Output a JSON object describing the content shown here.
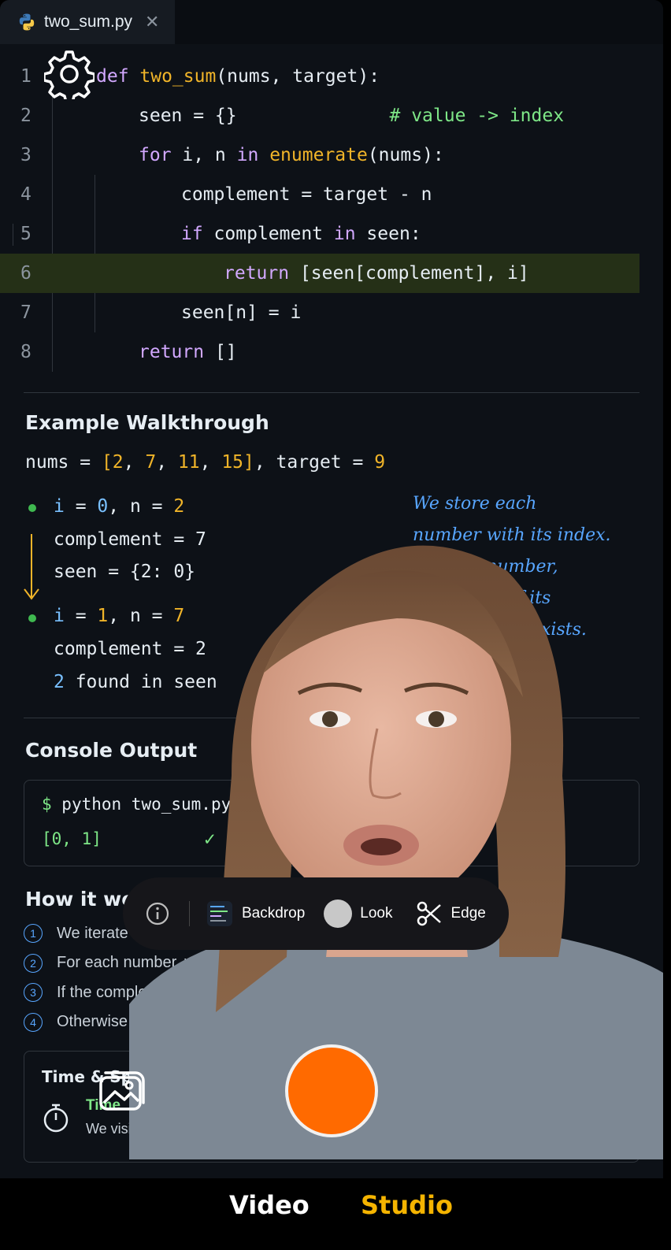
{
  "tab": {
    "filename": "two_sum.py",
    "close_glyph": "✕"
  },
  "code": {
    "lines": [
      {
        "num": "1",
        "parts": [
          [
            "kw",
            "def "
          ],
          [
            "fn",
            "two_sum"
          ],
          [
            "pl",
            "(nums, target):"
          ]
        ]
      },
      {
        "num": "2",
        "parts": [
          [
            "pl",
            "seen = {}"
          ],
          [
            "gap",
            "              "
          ],
          [
            "cm",
            "# value -> index"
          ]
        ]
      },
      {
        "num": "3",
        "parts": [
          [
            "kw",
            "for"
          ],
          [
            "pl",
            " i, n "
          ],
          [
            "kw",
            "in"
          ],
          [
            "pl",
            " "
          ],
          [
            "fn",
            "enumerate"
          ],
          [
            "pl",
            "(nums):"
          ]
        ]
      },
      {
        "num": "4",
        "parts": [
          [
            "pl",
            "complement = target - n"
          ]
        ]
      },
      {
        "num": "5",
        "parts": [
          [
            "kw",
            "if"
          ],
          [
            "pl",
            " complement "
          ],
          [
            "kw",
            "in"
          ],
          [
            "pl",
            " seen:"
          ]
        ]
      },
      {
        "num": "6",
        "parts": [
          [
            "kw",
            "return"
          ],
          [
            "pl",
            " [seen[complement], i]"
          ]
        ]
      },
      {
        "num": "7",
        "parts": [
          [
            "pl",
            "seen[n] = i"
          ]
        ]
      },
      {
        "num": "8",
        "parts": [
          [
            "kw",
            "return"
          ],
          [
            "pl",
            " []"
          ]
        ]
      }
    ]
  },
  "walkthrough": {
    "title": "Example Walkthrough",
    "input_parts": [
      [
        "pl",
        "nums = "
      ],
      [
        "num",
        "[2"
      ],
      [
        "pl",
        ", "
      ],
      [
        "num",
        "7"
      ],
      [
        "pl",
        ", "
      ],
      [
        "num",
        "11"
      ],
      [
        "pl",
        ", "
      ],
      [
        "num",
        "15]"
      ],
      [
        "pl",
        ", target = "
      ],
      [
        "num",
        "9"
      ]
    ],
    "step1": {
      "head": [
        [
          "var",
          "i"
        ],
        [
          "pl",
          " = "
        ],
        [
          "var",
          "0"
        ],
        [
          "pl",
          ", n = "
        ],
        [
          "num",
          "2"
        ]
      ],
      "l2": "complement = 7",
      "l3": "seen = {2: 0}"
    },
    "step2": {
      "head": [
        [
          "var",
          "i"
        ],
        [
          "pl",
          " = "
        ],
        [
          "num",
          "1"
        ],
        [
          "pl",
          ", n = "
        ],
        [
          "num",
          "7"
        ]
      ],
      "l2": "complement = 2",
      "l3_num": "2",
      "l3_rest": " found in seen"
    },
    "note_lines": [
      "We store each",
      "number with its index.",
      "h number,",
      "if its",
      "exists."
    ]
  },
  "console": {
    "title": "Console Output",
    "prompt": "$",
    "command": " python two_sum.py",
    "output": "[0, 1]",
    "check": "✓"
  },
  "how": {
    "title": "How it wor",
    "items": [
      {
        "n": "1",
        "text": "We iterate"
      },
      {
        "n": "2",
        "text": "For each number, w"
      },
      {
        "n": "3",
        "text": "If the comple"
      },
      {
        "n": "4",
        "text": "Otherwise"
      }
    ]
  },
  "card": {
    "title": "Time & Spa",
    "line1": "Time",
    "line2": "We visi"
  },
  "toolbar": {
    "backdrop": "Backdrop",
    "look": "Look",
    "edge": "Edge"
  },
  "modes": {
    "video": "Video",
    "studio": "Studio"
  },
  "colors": {
    "accent": "#ff6a00",
    "studio": "#f5b400",
    "keyword": "#d2a8ff",
    "function": "#f0b429",
    "comment": "#7ee787",
    "highlight": "#253017"
  }
}
